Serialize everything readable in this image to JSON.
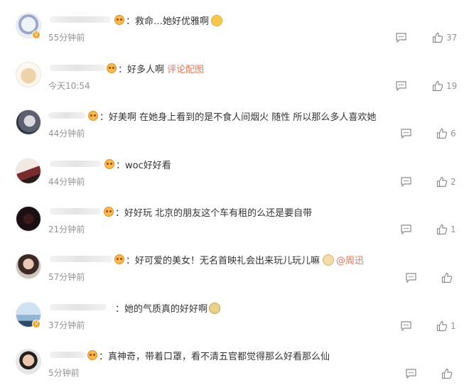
{
  "comments": [
    {
      "text": "救命…她好优雅啊",
      "time": "55分钟前",
      "likes": "37",
      "emoji": "cheer"
    },
    {
      "text": "好多人啊",
      "link": "评论配图",
      "time": "今天10:54",
      "likes": "19"
    },
    {
      "text": "好美啊 在她身上看到的是不食人间烟火 随性 所以那么多人喜欢她",
      "time": "44分钟前",
      "likes": "6"
    },
    {
      "text": "woc好好看",
      "time": "44分钟前",
      "likes": "2"
    },
    {
      "text": "好好玩 北京的朋友这个车有租的么还是要自带",
      "time": "21分钟前",
      "likes": "1"
    },
    {
      "text": "好可爱的美女！无名首映礼会出来玩儿玩儿嘛",
      "mention": "@周迅",
      "time": "57分钟前",
      "likes": "",
      "emoji": "dog"
    },
    {
      "text": "她的气质真的好好啊",
      "time": "37分钟前",
      "likes": "1",
      "emoji": "tea"
    },
    {
      "text": "真神奇，带着口罩，看不清五官都觉得那么好看那么仙",
      "time": "5分钟前",
      "likes": ""
    }
  ],
  "icons": {
    "reply": "comment-bubble-icon",
    "like": "thumbs-up-icon",
    "member": "member-badge-icon",
    "verified": "verified-v-icon"
  },
  "colors": {
    "text": "#333333",
    "meta": "#939393",
    "link": "#eb7350",
    "verified": "#f4a623"
  },
  "verified_glyph": "V",
  "colon": "："
}
